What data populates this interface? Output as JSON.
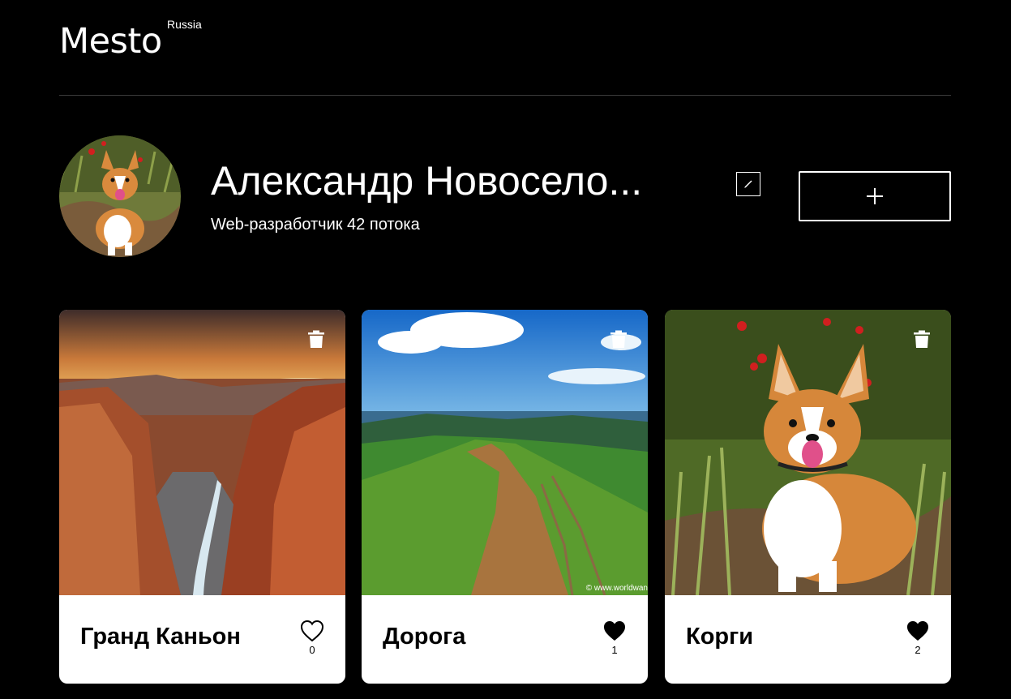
{
  "header": {
    "logo": "Mesto",
    "logo_sup": "Russia"
  },
  "profile": {
    "name": "Александр Новосело...",
    "about": "Web-разработчик 42 потока",
    "avatar_icon": "corgi-photo"
  },
  "icons": {
    "edit": "pencil-icon",
    "add": "plus-icon",
    "delete": "trash-icon",
    "like": "heart-icon"
  },
  "cards": [
    {
      "title": "Гранд Каньон",
      "likes": "0",
      "liked": false,
      "image": "grand-canyon-photo"
    },
    {
      "title": "Дорога",
      "likes": "1",
      "liked": true,
      "image": "mountain-road-photo",
      "watermark": "© www.worldwan"
    },
    {
      "title": "Корги",
      "likes": "2",
      "liked": true,
      "image": "corgi-photo"
    }
  ],
  "colors": {
    "background": "#000000",
    "card": "#ffffff",
    "text_dark": "#000000",
    "divider": "#545454"
  }
}
